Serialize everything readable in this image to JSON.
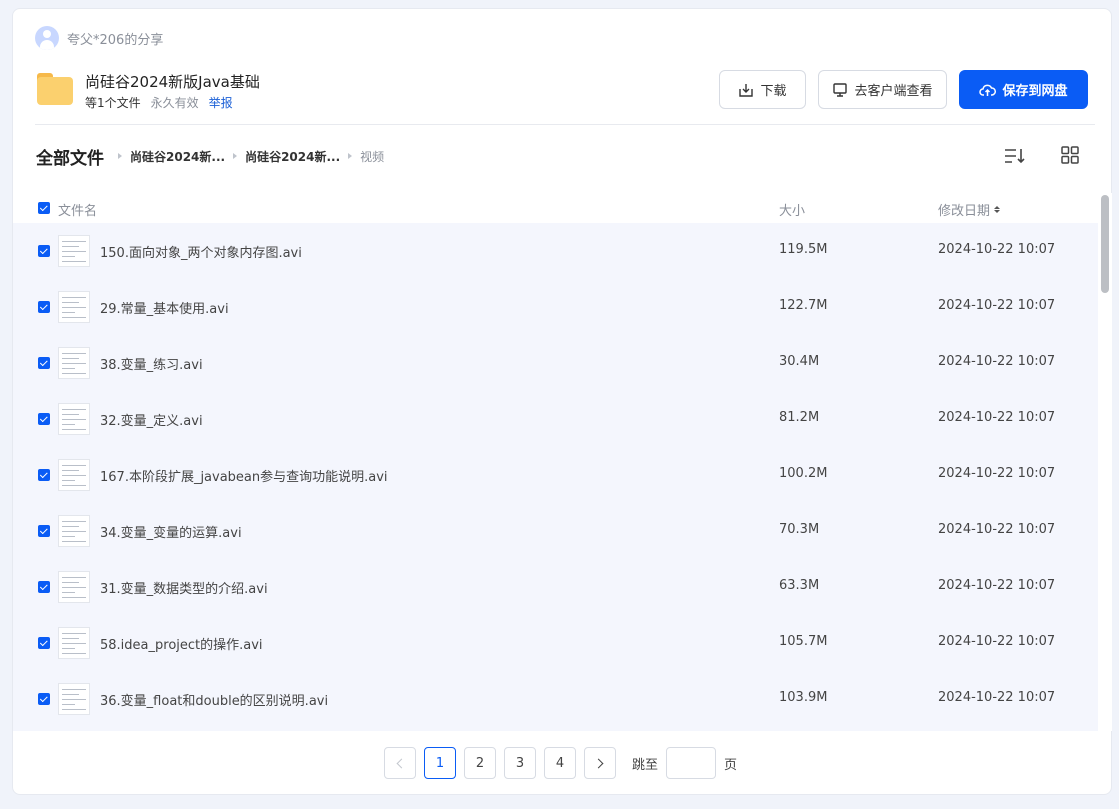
{
  "sharer": {
    "name": "夸父*206的分享"
  },
  "share": {
    "title": "尚硅谷2024新版Java基础",
    "file_count": "等1个文件",
    "validity": "永久有效",
    "report": "举报"
  },
  "actions": {
    "download": "下载",
    "client_view": "去客户端查看",
    "save": "保存到网盘"
  },
  "breadcrumb": {
    "root": "全部文件",
    "items": [
      "尚硅谷2024新...",
      "尚硅谷2024新...",
      "视频"
    ]
  },
  "table": {
    "columns": {
      "name": "文件名",
      "size": "大小",
      "date": "修改日期"
    },
    "rows": [
      {
        "name": "150.面向对象_两个对象内存图.avi",
        "size": "119.5M",
        "date": "2024-10-22 10:07"
      },
      {
        "name": "29.常量_基本使用.avi",
        "size": "122.7M",
        "date": "2024-10-22 10:07"
      },
      {
        "name": "38.变量_练习.avi",
        "size": "30.4M",
        "date": "2024-10-22 10:07"
      },
      {
        "name": "32.变量_定义.avi",
        "size": "81.2M",
        "date": "2024-10-22 10:07"
      },
      {
        "name": "167.本阶段扩展_javabean参与查询功能说明.avi",
        "size": "100.2M",
        "date": "2024-10-22 10:07"
      },
      {
        "name": "34.变量_变量的运算.avi",
        "size": "70.3M",
        "date": "2024-10-22 10:07"
      },
      {
        "name": "31.变量_数据类型的介绍.avi",
        "size": "63.3M",
        "date": "2024-10-22 10:07"
      },
      {
        "name": "58.idea_project的操作.avi",
        "size": "105.7M",
        "date": "2024-10-22 10:07"
      },
      {
        "name": "36.变量_float和double的区别说明.avi",
        "size": "103.9M",
        "date": "2024-10-22 10:07"
      }
    ]
  },
  "pagination": {
    "pages": [
      "1",
      "2",
      "3",
      "4"
    ],
    "current": "1",
    "jump_label": "跳至",
    "jump_value": "",
    "page_unit": "页"
  },
  "colors": {
    "accent": "#0a5cf5",
    "folder": "#fbd06e"
  }
}
